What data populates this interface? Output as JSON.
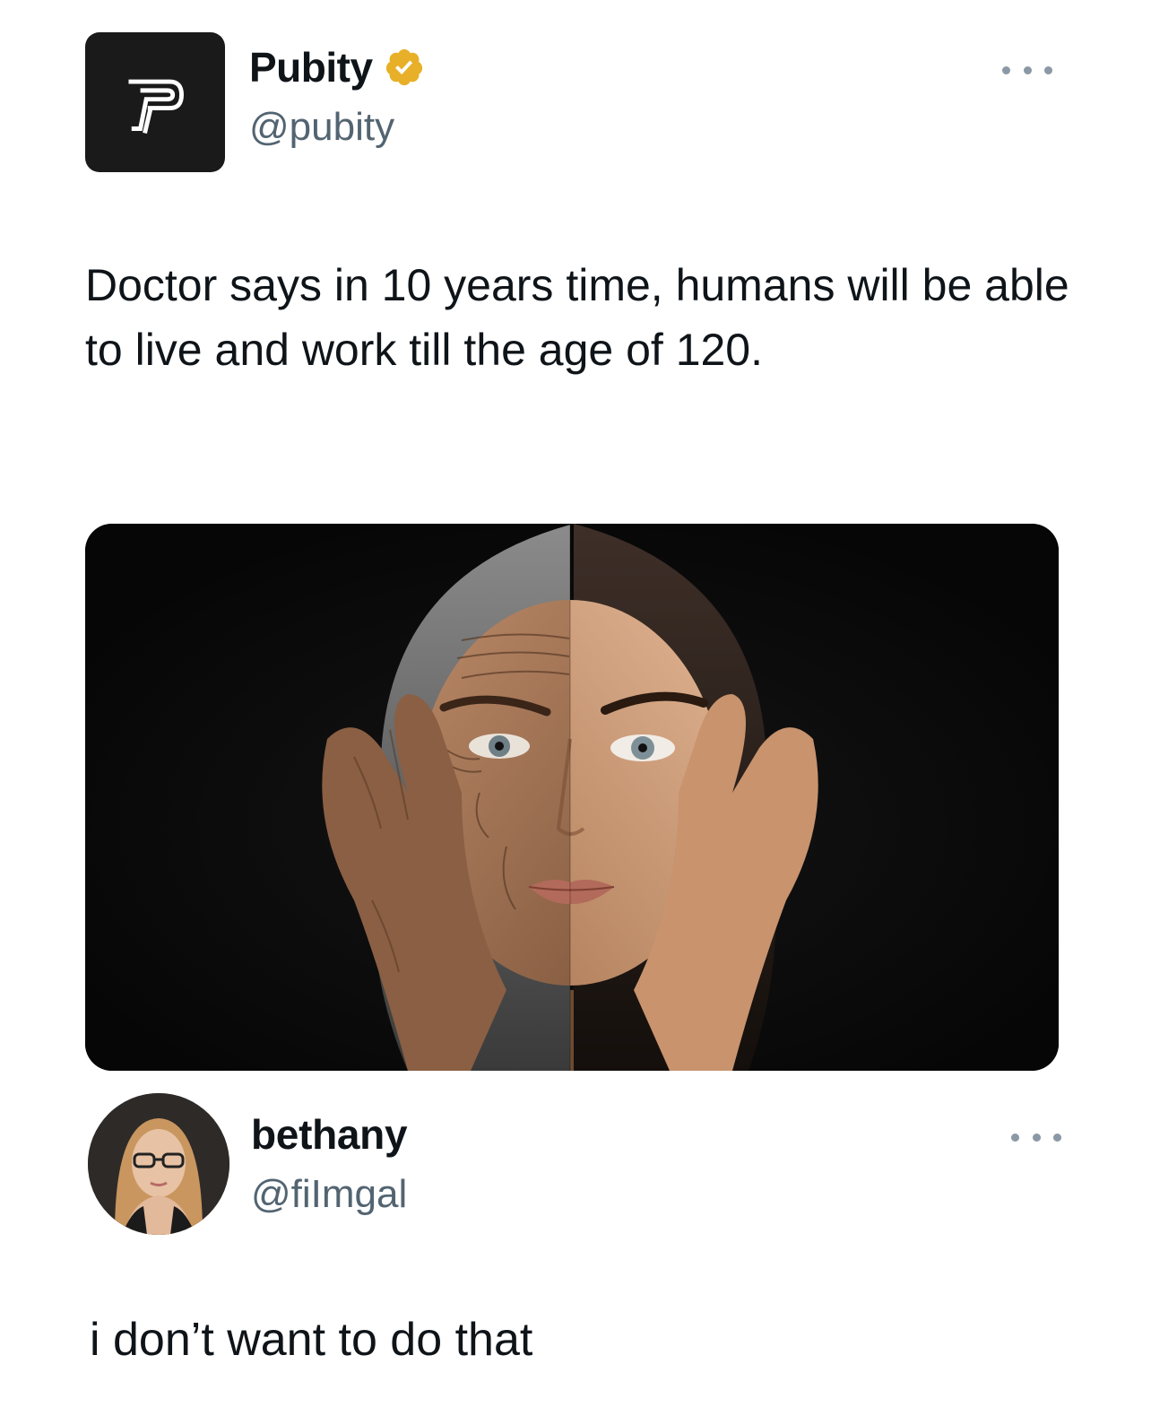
{
  "post": {
    "display_name": "Pubity",
    "handle": "@pubity",
    "verified": true,
    "verified_badge_color": "#e8b028",
    "avatar_icon": "pubity-p-logo",
    "text": "Doctor says in 10 years time, humans will be able to live and work till the age of 120.",
    "menu_icon": "more-horizontal-icon"
  },
  "image": {
    "alt_subject": "face-half-aged-half-young"
  },
  "reply": {
    "display_name": "bethany",
    "handle": "@fiImgal",
    "text": "i don’t want to do that",
    "menu_icon": "more-horizontal-icon"
  },
  "colors": {
    "text_primary": "#0f1419",
    "text_secondary": "#536471",
    "background": "#ffffff"
  }
}
